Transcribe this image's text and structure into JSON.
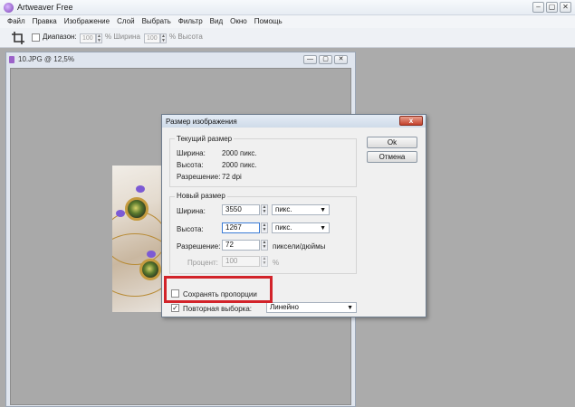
{
  "app": {
    "title": "Artweaver Free",
    "window_buttons": [
      "–",
      "▢",
      "✕"
    ]
  },
  "menu": [
    "Файл",
    "Правка",
    "Изображение",
    "Слой",
    "Выбрать",
    "Фильтр",
    "Вид",
    "Окно",
    "Помощь"
  ],
  "toolbar": {
    "range_label": "Диапазон:",
    "range_value": "100",
    "width_label": "% Ширина",
    "width_value": "100",
    "height_label": "% Высота"
  },
  "document": {
    "title": "10.JPG @ 12,5%",
    "buttons": [
      "—",
      "▢",
      "✕"
    ]
  },
  "dialog": {
    "title": "Размер изображения",
    "close": "x",
    "current": {
      "title": "Текущий размер",
      "width_label": "Ширина:",
      "width_value": "2000 пикс.",
      "height_label": "Высота:",
      "height_value": "2000 пикс.",
      "resolution_label": "Разрешение:",
      "resolution_value": "72 dpi"
    },
    "new": {
      "title": "Новый размер",
      "width_label": "Ширина:",
      "width_value": "3550",
      "width_unit": "пикс.",
      "height_label": "Высота:",
      "height_value": "1267",
      "height_unit": "пикс.",
      "resolution_label": "Разрешение:",
      "resolution_value": "72",
      "resolution_unit": "пиксели/дюймы",
      "percent_label": "Процент:",
      "percent_value": "100",
      "percent_unit": "%"
    },
    "keep_proportions": "Сохранять пропорции",
    "resample_label": "Повторная выборка:",
    "resample_value": "Линейно",
    "ok": "Ok",
    "cancel": "Отмена"
  }
}
